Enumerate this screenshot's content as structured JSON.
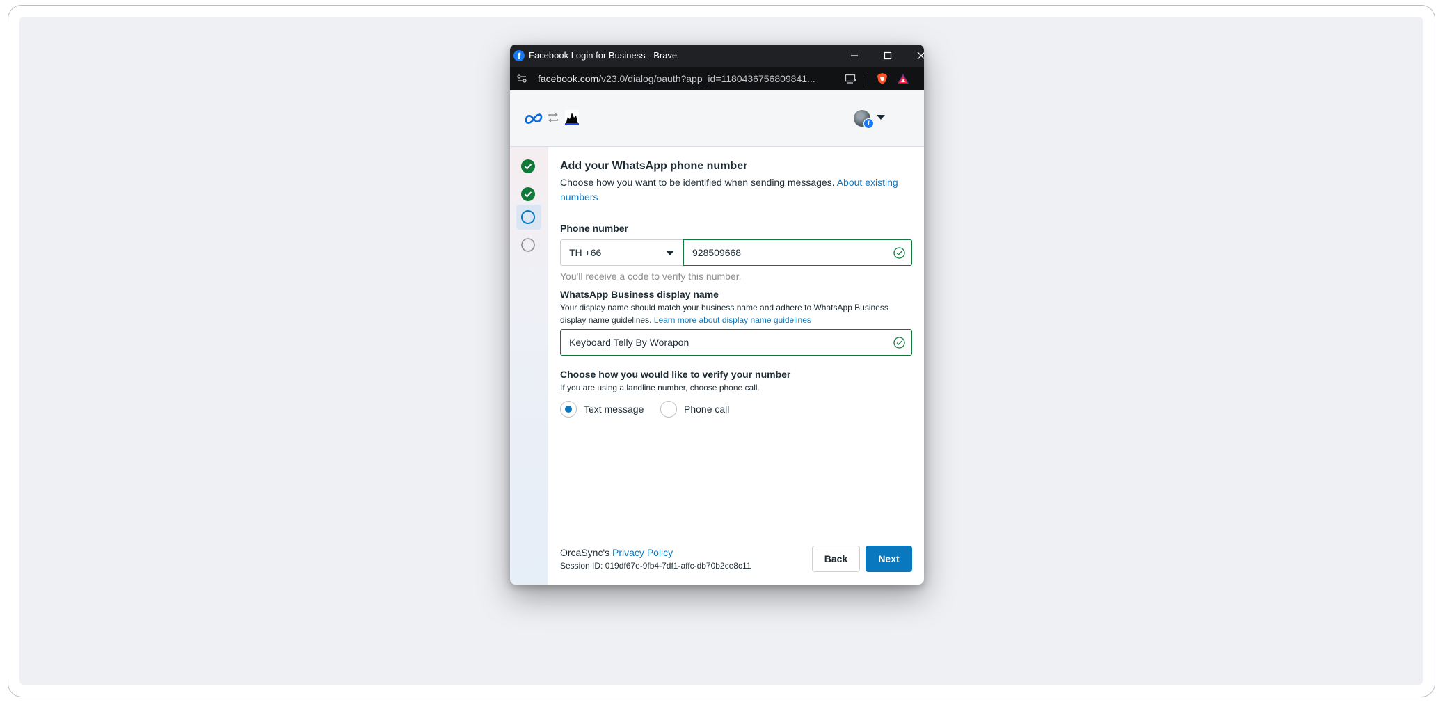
{
  "window": {
    "title": "Facebook Login for Business - Brave",
    "favicon_icon": "facebook-icon"
  },
  "addressbar": {
    "url_host": "facebook.com",
    "url_path": "/v23.0/dialog/oauth?app_id=1180436756809841..."
  },
  "header": {
    "logo_icon": "meta-logo",
    "account_icon": "facebook-badge-icon"
  },
  "stepper": {
    "steps": [
      {
        "state": "completed"
      },
      {
        "state": "completed"
      },
      {
        "state": "active"
      },
      {
        "state": "pending"
      }
    ]
  },
  "main": {
    "title": "Add your WhatsApp phone number",
    "subtitle": "Choose how you want to be identified when sending messages.",
    "subtitle_link": "About existing numbers",
    "phone": {
      "label": "Phone number",
      "country_code": "TH +66",
      "number": "928509668",
      "helper": "You'll receive a code to verify this number."
    },
    "display_name": {
      "label": "WhatsApp Business display name",
      "description": "Your display name should match your business name and adhere to WhatsApp Business display name guidelines.",
      "link": "Learn more about display name guidelines",
      "value": "Keyboard Telly By Worapon"
    },
    "verify": {
      "label": "Choose how you would like to verify your number",
      "hint": "If you are using a landline number, choose phone call.",
      "options": [
        {
          "label": "Text message",
          "selected": true
        },
        {
          "label": "Phone call",
          "selected": false
        }
      ]
    }
  },
  "footer": {
    "owner": "OrcaSync's",
    "privacy_link": "Privacy Policy",
    "session": "Session ID: 019df67e-9fb4-7df1-affc-db70b2ce8c11",
    "back_label": "Back",
    "next_label": "Next"
  },
  "colors": {
    "accent": "#0a78be",
    "success": "#117a3b",
    "titlebar": "#202124"
  }
}
